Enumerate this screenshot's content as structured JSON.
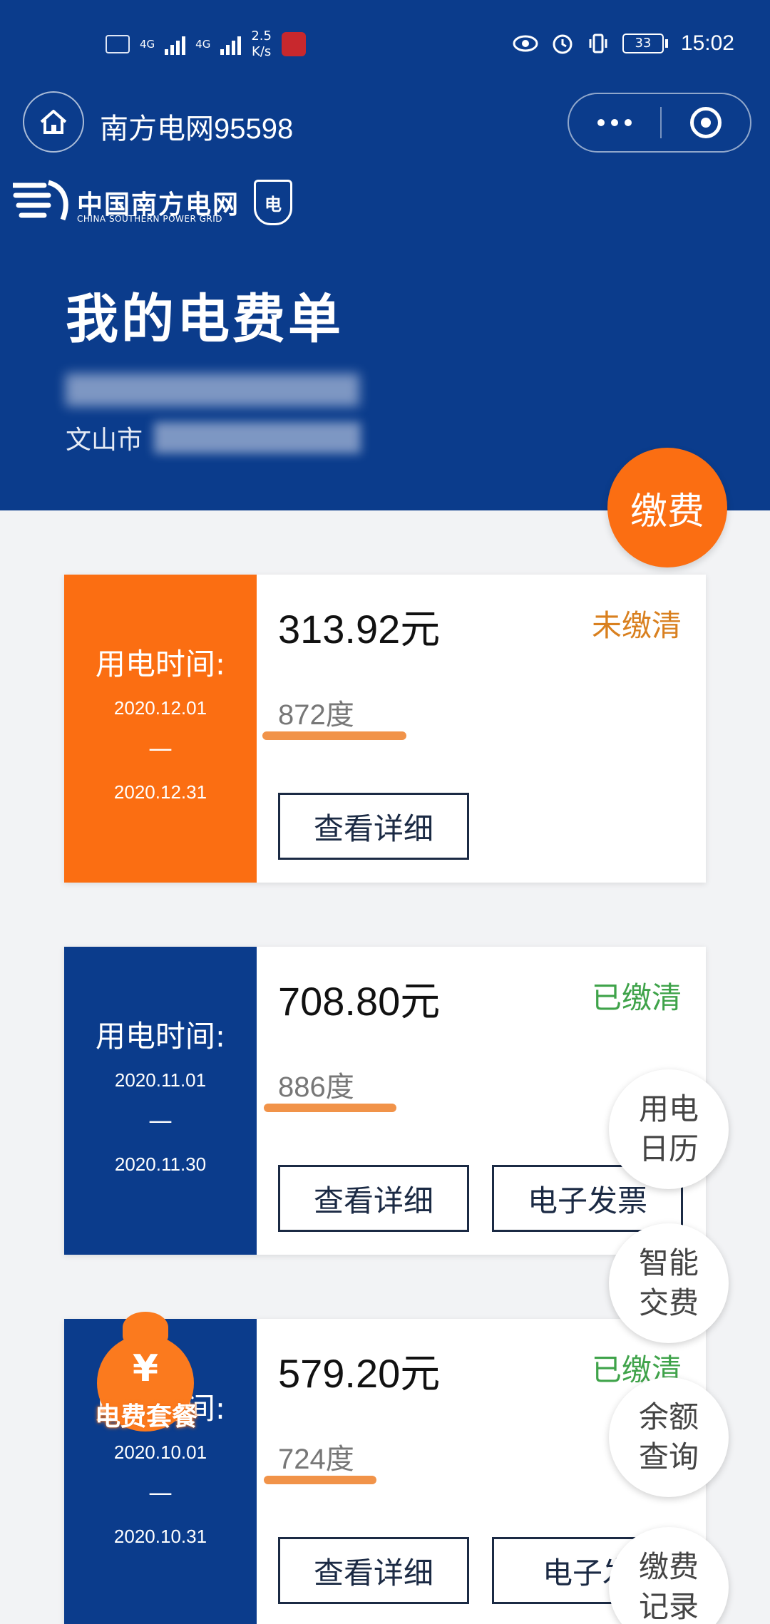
{
  "status_bar": {
    "net1": "4G",
    "net2": "4G",
    "speed": "2.5\nK/s",
    "battery": "33",
    "time": "15:02"
  },
  "nav": {
    "title": "南方电网95598"
  },
  "brand": {
    "name_cn": "中国南方电网",
    "name_en": "CHINA SOUTHERN POWER GRID",
    "badge": "电"
  },
  "page": {
    "title": "我的电费单",
    "address_city": "文山市"
  },
  "pay_button": "缴费",
  "bills": [
    {
      "period_label": "用电时间:",
      "start": "2020.12.01",
      "dash": "—",
      "end": "2020.12.31",
      "amount": "313.92元",
      "status": "未缴清",
      "usage": "872度",
      "detail_label": "查看详细"
    },
    {
      "period_label": "用电时间:",
      "start": "2020.11.01",
      "dash": "—",
      "end": "2020.11.30",
      "amount": "708.80元",
      "status": "已缴清",
      "usage": "886度",
      "detail_label": "查看详细",
      "invoice_label": "电子发票"
    },
    {
      "period_label": "用电时间:",
      "start": "2020.10.01",
      "dash": "—",
      "end": "2020.10.31",
      "amount": "579.20元",
      "status": "已缴清",
      "usage": "724度",
      "detail_label": "查看详细",
      "invoice_label": "电子发"
    }
  ],
  "floating": [
    "用电\n日历",
    "智能\n交费",
    "余额\n查询",
    "缴费\n记录"
  ],
  "package_badge": {
    "symbol": "¥",
    "label": "电费套餐"
  },
  "colors": {
    "header_blue": "#0b3c8c",
    "accent_orange": "#fb6e12",
    "paid_green": "#3fa34a",
    "unpaid_orange": "#d9801f"
  }
}
